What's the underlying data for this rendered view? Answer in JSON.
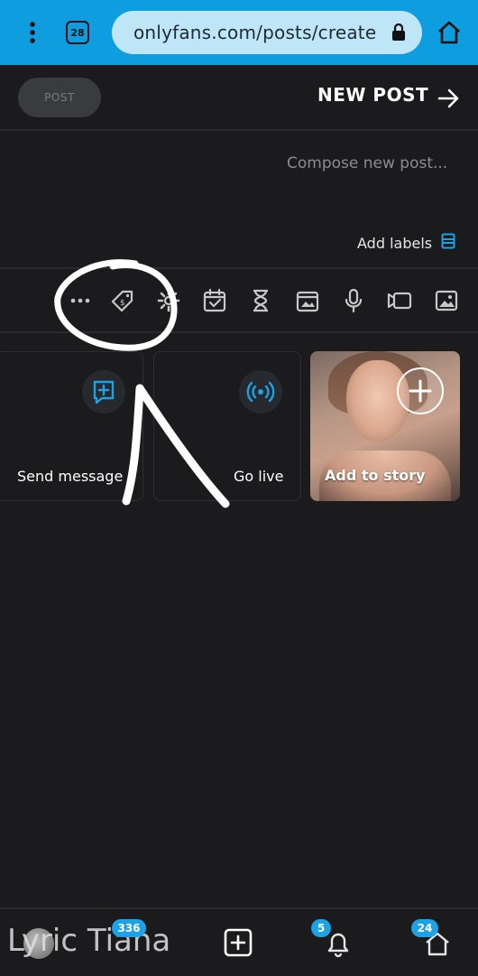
{
  "browser": {
    "url": "onlyfans.com/posts/create",
    "tab_count": "28"
  },
  "header": {
    "title": "NEW POST",
    "post_button": "POST"
  },
  "compose": {
    "placeholder": "Compose new post..."
  },
  "labels": {
    "add_labels": "Add labels"
  },
  "toolbar": {
    "icons": [
      "image-icon",
      "video-icon",
      "microphone-icon",
      "gallery-icon",
      "hourglass-icon",
      "calendar-icon",
      "settings-icon",
      "price-tag-icon",
      "more-icon"
    ]
  },
  "cards": {
    "story": "Add to story",
    "live": "Go live",
    "message": "Send message"
  },
  "bottom_nav": {
    "home_badge": "24",
    "notifications_badge": "5",
    "messages_badge": "336",
    "user_name": "Lyric Tiana"
  },
  "colors": {
    "browser_bar": "#0e9ddf",
    "accent": "#1ea2e6",
    "background": "#1b1b1d"
  }
}
